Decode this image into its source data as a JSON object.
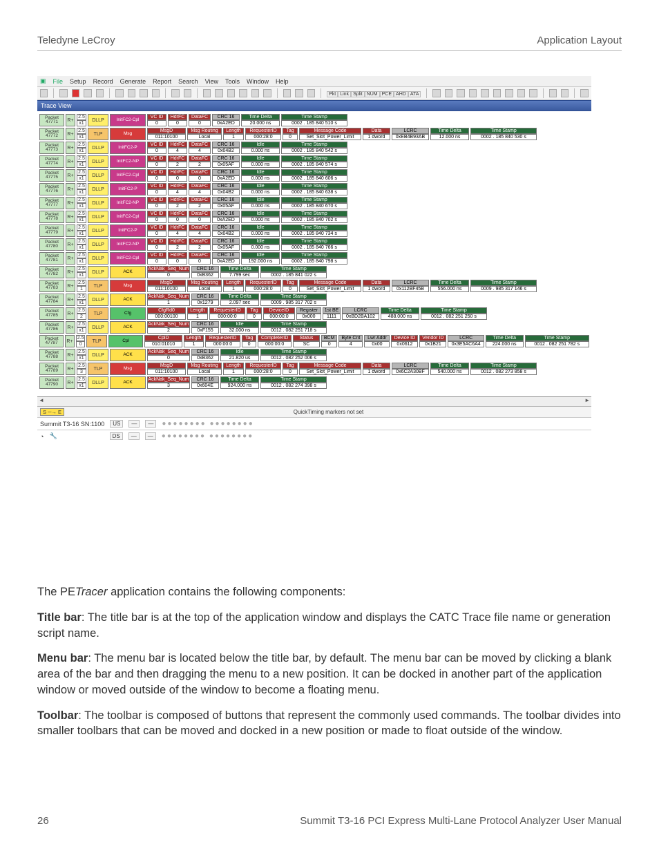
{
  "header": {
    "left": "Teledyne LeCroy",
    "right": "Application Layout"
  },
  "footer": {
    "page": "26",
    "title": "Summit T3-16 PCI Express Multi-Lane Protocol Analyzer User Manual"
  },
  "menu": {
    "items": [
      "File",
      "Setup",
      "Record",
      "Generate",
      "Report",
      "Search",
      "View",
      "Tools",
      "Window",
      "Help"
    ]
  },
  "toolbar_group": [
    "Pkt",
    "Link",
    "Split",
    "NUM",
    "PCE",
    "AHD",
    "ATA"
  ],
  "tracehdr": "Trace View",
  "rows_dllp": [
    {
      "num": "47771",
      "kind": "InitFC2-Cpl",
      "kclass": "k-initc",
      "vc": "0",
      "hdr": "0",
      "dfc": "0",
      "crc": "0xA2ED",
      "td": "20.000 ns",
      "ts": "0002 . 185 840 510 s",
      "td_hdr": "Time Delta"
    },
    {
      "num": "47773",
      "kind": "InitFC2-P",
      "kclass": "k-initp",
      "vc": "0",
      "hdr": "4",
      "dfc": "4",
      "crc": "0x04B2",
      "td": "0.000 ns",
      "ts": "0002 . 185 840 542 s",
      "td_hdr": "Idle"
    },
    {
      "num": "47774",
      "kind": "InitFC2-NP",
      "kclass": "k-initnp",
      "vc": "0",
      "hdr": "2",
      "dfc": "2",
      "crc": "0x05AF",
      "td": "0.000 ns",
      "ts": "0002 . 185 840 574 s",
      "td_hdr": "Idle"
    },
    {
      "num": "47775",
      "kind": "InitFC2-Cpl",
      "kclass": "k-initc",
      "vc": "0",
      "hdr": "0",
      "dfc": "0",
      "crc": "0xA2ED",
      "td": "0.000 ns",
      "ts": "0002 . 185 840 606 s",
      "td_hdr": "Idle"
    },
    {
      "num": "47776",
      "kind": "InitFC2-P",
      "kclass": "k-initp",
      "vc": "0",
      "hdr": "4",
      "dfc": "4",
      "crc": "0x04B2",
      "td": "0.000 ns",
      "ts": "0002 . 185 840 638 s",
      "td_hdr": "Idle"
    },
    {
      "num": "47777",
      "kind": "InitFC2-NP",
      "kclass": "k-initnp",
      "vc": "0",
      "hdr": "2",
      "dfc": "2",
      "crc": "0x05AF",
      "td": "0.000 ns",
      "ts": "0002 . 185 840 670 s",
      "td_hdr": "Idle"
    },
    {
      "num": "47778",
      "kind": "InitFC2-Cpl",
      "kclass": "k-initc",
      "vc": "0",
      "hdr": "0",
      "dfc": "0",
      "crc": "0xA2ED",
      "td": "0.000 ns",
      "ts": "0002 . 185 840 702 s",
      "td_hdr": "Idle"
    },
    {
      "num": "47779",
      "kind": "InitFC2-P",
      "kclass": "k-initp",
      "vc": "0",
      "hdr": "4",
      "dfc": "4",
      "crc": "0x04B2",
      "td": "0.000 ns",
      "ts": "0002 . 185 840 734 s",
      "td_hdr": "Idle"
    },
    {
      "num": "47780",
      "kind": "InitFC2-NP",
      "kclass": "k-initnp",
      "vc": "0",
      "hdr": "2",
      "dfc": "2",
      "crc": "0x05AF",
      "td": "0.000 ns",
      "ts": "0002 . 185 840 766 s",
      "td_hdr": "Idle"
    },
    {
      "num": "47781",
      "kind": "InitFC2-Cpl",
      "kclass": "k-initc",
      "vc": "0",
      "hdr": "0",
      "dfc": "0",
      "crc": "0xA2ED",
      "td": "192.000 ns",
      "ts": "0002 . 185 840 798 s",
      "td_hdr": "Idle"
    }
  ],
  "row_ack_a": {
    "num": "47782",
    "ann": "0",
    "crc": "0xB362",
    "td": "7.799 sec",
    "ts": "0002 . 185 841 022 s"
  },
  "row_tlp_msg1": {
    "num": "47772",
    "x": "x1",
    "msgd": "011:10100",
    "mgr": "Local",
    "len": "1",
    "req": "000:28:0",
    "tag": "0",
    "mcode": "Set_Slot_Power_Limit",
    "data": "1 dword",
    "lcrc": "0xEB4B93AB",
    "td": "12.000 ns",
    "ts": "0002 . 185 840 530 s"
  },
  "row_tlp_msg2": {
    "num": "47783",
    "x": "1",
    "msgd": "011:10100",
    "mgr": "Local",
    "len": "1",
    "req": "000:28:0",
    "tag": "0",
    "mcode": "Set_Slot_Power_Limit",
    "data": "1 dword",
    "lcrc": "0x112BF45B",
    "td": "556.000 ns",
    "ts": "0009 . 985 317 146 s"
  },
  "row_ack_b": {
    "num": "47784",
    "ann": "1",
    "crc": "0x1279",
    "td": "2.097 sec",
    "ts": "0009 . 985 317 702 s"
  },
  "row_cfg": {
    "num": "47785",
    "x": "2",
    "d": "000:00100",
    "len": "1",
    "req": "000:00:0",
    "tag": "0",
    "dev": "000:00:0",
    "reg": "0x000",
    "be": "1111",
    "lcrc": "0xBD2BA102",
    "td": "488.000 ns",
    "ts": "0012 . 082 251 250 s"
  },
  "row_ack_c": {
    "num": "47786",
    "ann": "2",
    "crc": "0xF155",
    "td": "32.000 ns",
    "ts": "0012 . 082 251 718 s",
    "td_hdr": "Idle"
  },
  "row_cpl": {
    "num": "47787",
    "x": "0",
    "cpld": "010:01010",
    "len": "1",
    "req": "000:00:0",
    "tag": "0",
    "cmp": "000:00:0",
    "stat": "SC",
    "bcm": "0",
    "bc": "4",
    "la": "0x00",
    "devid": "0x0612",
    "vendid": "0x1B21",
    "lcrc": "0x3E5AC6A4",
    "td": "224.000 ns",
    "ts": "0012 . 082 251 782 s"
  },
  "row_ack_d": {
    "num": "47788",
    "ann": "0",
    "crc": "0xB362",
    "td": "21.820 us",
    "ts": "0012 . 082 252 006 s",
    "td_hdr": "Idle"
  },
  "row_tlp_msg3": {
    "num": "47789",
    "x": "3",
    "msgd": "011:10100",
    "mgr": "Local",
    "len": "1",
    "req": "000:28:0",
    "tag": "0",
    "mcode": "Set_Slot_Power_Limit",
    "data": "1 dword",
    "lcrc": "0x6C2A30BF",
    "td": "540.000 ns",
    "ts": "0012 . 082 273 858 s"
  },
  "row_ack_e": {
    "num": "47790",
    "ann": "3",
    "crc": "0x604E",
    "td": "924.000 ns",
    "ts": "0012 . 082 274 398 s"
  },
  "labels": {
    "packet": "Packet",
    "rplus": "R+",
    "g25": "2.5",
    "gx1": "x1",
    "dllp": "DLLP",
    "tlp": "TLP",
    "ack": "ACK",
    "msg": "Msg",
    "cfg": "Cfg",
    "cpl": "Cpl",
    "vcid": "VC ID",
    "hdrfc": "HdrFC",
    "datafc": "DataFC",
    "crc16": "CRC 16",
    "timedelta": "Time Delta",
    "timestamp": "Time Stamp",
    "idle": "Idle",
    "msgd": "MsgD",
    "mgr": "Msg Routing",
    "length": "Length",
    "reqid": "RequesterID",
    "tag": "Tag",
    "mcode": "Message Code",
    "data": "Data",
    "lcrc": "LCRC",
    "ann": "AckNak_Seq_Num",
    "cfgrd0": "CfgRd0",
    "devid": "DeviceID",
    "register": "Register",
    "firstbe": "1st BE",
    "cpld": "CplD",
    "completerid": "CompleterID",
    "status": "Status",
    "bcm": "BCM",
    "bytecnt": "Byte Cnt",
    "lwraddr": "Lwr Addr",
    "device_id": "Device ID",
    "vendor_id": "Vendor ID"
  },
  "se": {
    "chip": "S ─→ E",
    "msg": "QuickTiming markers not set"
  },
  "status": {
    "device": "Summit T3-16 SN:1100",
    "us": "US",
    "ds": "DS",
    "dash": "—",
    "leds": "●●●●●●●● ●●●●●●●●"
  },
  "body": {
    "intro": "The PETracer application contains the following components:",
    "title_h": "Title bar",
    "title_t": ": The title bar is at the top of the application window and displays the CATC Trace file name or generation script name.",
    "menu_h": "Menu bar",
    "menu_t": ": The menu bar is located below the title bar, by default. The menu bar can be moved by clicking a blank area of the bar and then dragging the menu to a new position. It can be docked in another part of the application window or moved outside of the window to become a floating menu.",
    "tool_h": "Toolbar",
    "tool_t": ": The toolbar is composed of buttons that represent the commonly used commands. The toolbar divides into smaller toolbars that can be moved and docked in a new position or made to float outside of the window."
  },
  "i": {
    "tracer_pre": "The PE",
    "tracer_it": "Tracer",
    "tracer_post": " application contains the following components:"
  }
}
